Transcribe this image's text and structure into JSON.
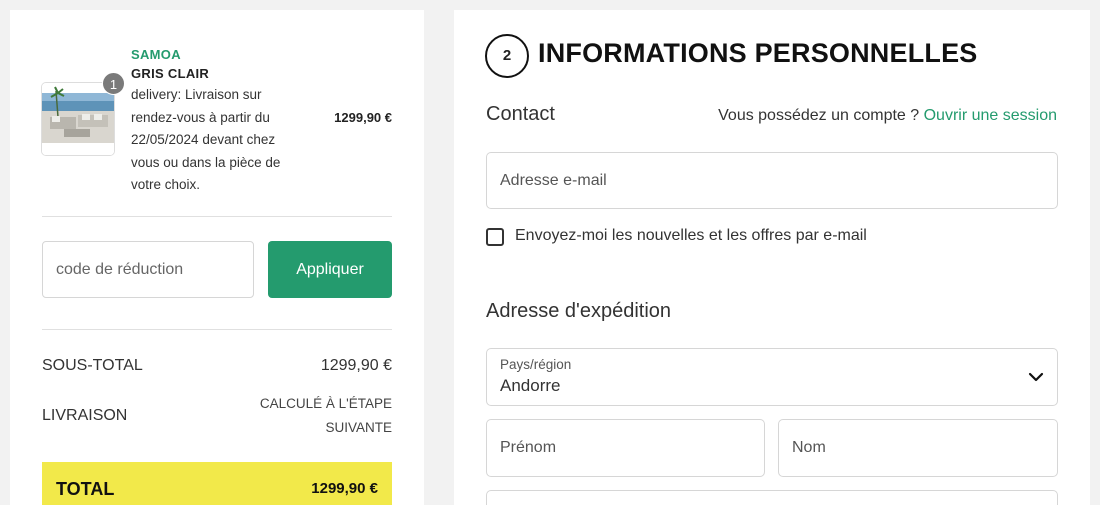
{
  "cart": {
    "quantity": "1",
    "product_name": "SAMOA",
    "product_variant": "GRIS CLAIR",
    "delivery_note": "delivery: Livraison sur rendez-vous à partir du 22/05/2024 devant chez vous ou dans la pièce de votre choix.",
    "price": "1299,90 €",
    "image_icon": "outdoor-sofa-image"
  },
  "discount": {
    "placeholder": "code de réduction",
    "apply_label": "Appliquer"
  },
  "summary": {
    "subtotal_label": "SOUS-TOTAL",
    "subtotal_value": "1299,90 €",
    "shipping_label": "LIVRAISON",
    "shipping_value": "CALCULÉ À L'ÉTAPE SUIVANTE",
    "total_label": "TOTAL",
    "total_value": "1299,90 €"
  },
  "personal": {
    "step_number": "2",
    "title": "INFORMATIONS PERSONNELLES",
    "contact_heading": "Contact",
    "account_question": "Vous possédez un compte ?",
    "login_link": "Ouvrir une session",
    "email_placeholder": "Adresse e-mail",
    "newsletter_label": "Envoyez-moi les nouvelles et les offres par e-mail",
    "newsletter_checked": false
  },
  "shipping": {
    "heading": "Adresse d'expédition",
    "country_label": "Pays/région",
    "country_value": "Andorre",
    "first_name_placeholder": "Prénom",
    "last_name_placeholder": "Nom"
  },
  "colors": {
    "accent_green": "#249b6e",
    "total_yellow": "#f2e94a",
    "background": "#f2f2f2"
  }
}
